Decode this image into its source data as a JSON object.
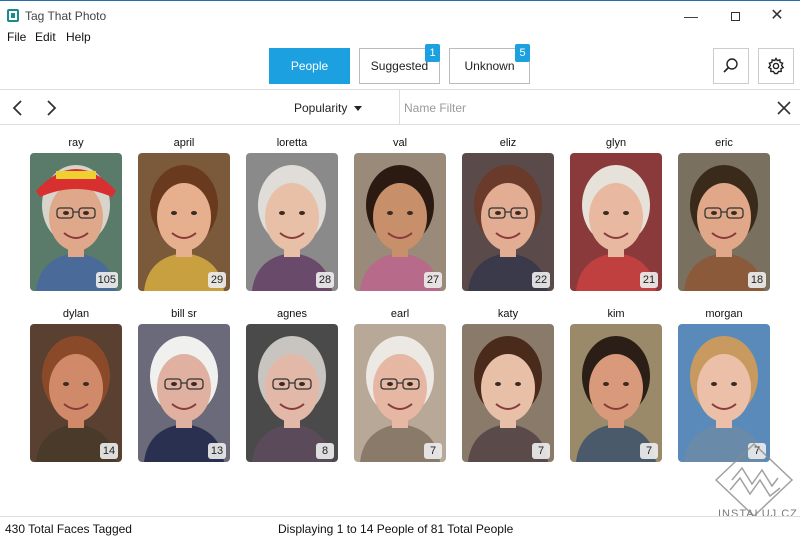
{
  "window": {
    "title": "Tag That Photo",
    "minimize": "—",
    "close": "✕"
  },
  "menu": [
    "File",
    "Edit",
    "Help"
  ],
  "tabs": [
    {
      "label": "People",
      "active": true,
      "badge": null
    },
    {
      "label": "Suggested",
      "active": false,
      "badge": "1"
    },
    {
      "label": "Unknown",
      "active": false,
      "badge": "5"
    }
  ],
  "toolbar": {
    "sort_label": "Popularity",
    "filter_placeholder": "Name Filter"
  },
  "people": [
    {
      "name": "ray",
      "count": "105",
      "bg": "#5a7a6a",
      "skin": "#e0a88a",
      "hair": "#d8d4cc",
      "shirt": "#4a6a9a",
      "hat": true,
      "glasses": true
    },
    {
      "name": "april",
      "count": "29",
      "bg": "#7a5a3a",
      "skin": "#e6b08e",
      "hair": "#6a3a1e",
      "shirt": "#c8a040",
      "glasses": false
    },
    {
      "name": "loretta",
      "count": "28",
      "bg": "#8a8a8a",
      "skin": "#e8c0a8",
      "hair": "#e0ddd8",
      "shirt": "#6a4a6a",
      "glasses": false
    },
    {
      "name": "val",
      "count": "27",
      "bg": "#9a8a7a",
      "skin": "#c8906a",
      "hair": "#2a1a12",
      "shirt": "#b86a8a",
      "glasses": false
    },
    {
      "name": "eliz",
      "count": "22",
      "bg": "#5a4a4a",
      "skin": "#e2ad92",
      "hair": "#6a3a2a",
      "shirt": "#3a3a4a",
      "glasses": true
    },
    {
      "name": "glyn",
      "count": "21",
      "bg": "#8a3a3a",
      "skin": "#e8b8a0",
      "hair": "#e6e2da",
      "shirt": "#c04040",
      "glasses": false
    },
    {
      "name": "eric",
      "count": "18",
      "bg": "#7a7060",
      "skin": "#e0a888",
      "hair": "#3a2a1a",
      "shirt": "#8a5a3a",
      "glasses": true
    },
    {
      "name": "dylan",
      "count": "14",
      "bg": "#5a4030",
      "skin": "#d08a6a",
      "hair": "#8a4a2a",
      "shirt": "#4a3a2a",
      "glasses": false
    },
    {
      "name": "bill sr",
      "count": "13",
      "bg": "#6a6a7a",
      "skin": "#e0b0a0",
      "hair": "#f0f0ee",
      "shirt": "#2a3050",
      "glasses": true
    },
    {
      "name": "agnes",
      "count": "8",
      "bg": "#4a4a4a",
      "skin": "#e2b8a8",
      "hair": "#c8c4c0",
      "shirt": "#5a4a5a",
      "glasses": true
    },
    {
      "name": "earl",
      "count": "7",
      "bg": "#b8a898",
      "skin": "#e6b8a4",
      "hair": "#ece8e4",
      "shirt": "#8a7a6a",
      "glasses": true
    },
    {
      "name": "katy",
      "count": "7",
      "bg": "#8a7a6a",
      "skin": "#e8c0a8",
      "hair": "#4a2a1a",
      "shirt": "#5a4a4a",
      "glasses": false
    },
    {
      "name": "kim",
      "count": "7",
      "bg": "#9a8a6a",
      "skin": "#d89a7a",
      "hair": "#2a1e16",
      "shirt": "#4a5a6a",
      "glasses": false
    },
    {
      "name": "morgan",
      "count": "7",
      "bg": "#5a8aba",
      "skin": "#ecc0a8",
      "hair": "#c89a60",
      "shirt": "#6a8aaa",
      "glasses": false
    }
  ],
  "status": {
    "total_tagged": "430 Total Faces Tagged",
    "displaying": "Displaying 1 to 14 People of 81 Total People"
  },
  "watermark": "INSTALUJ.CZ",
  "colors": {
    "accent": "#1da0e0"
  }
}
